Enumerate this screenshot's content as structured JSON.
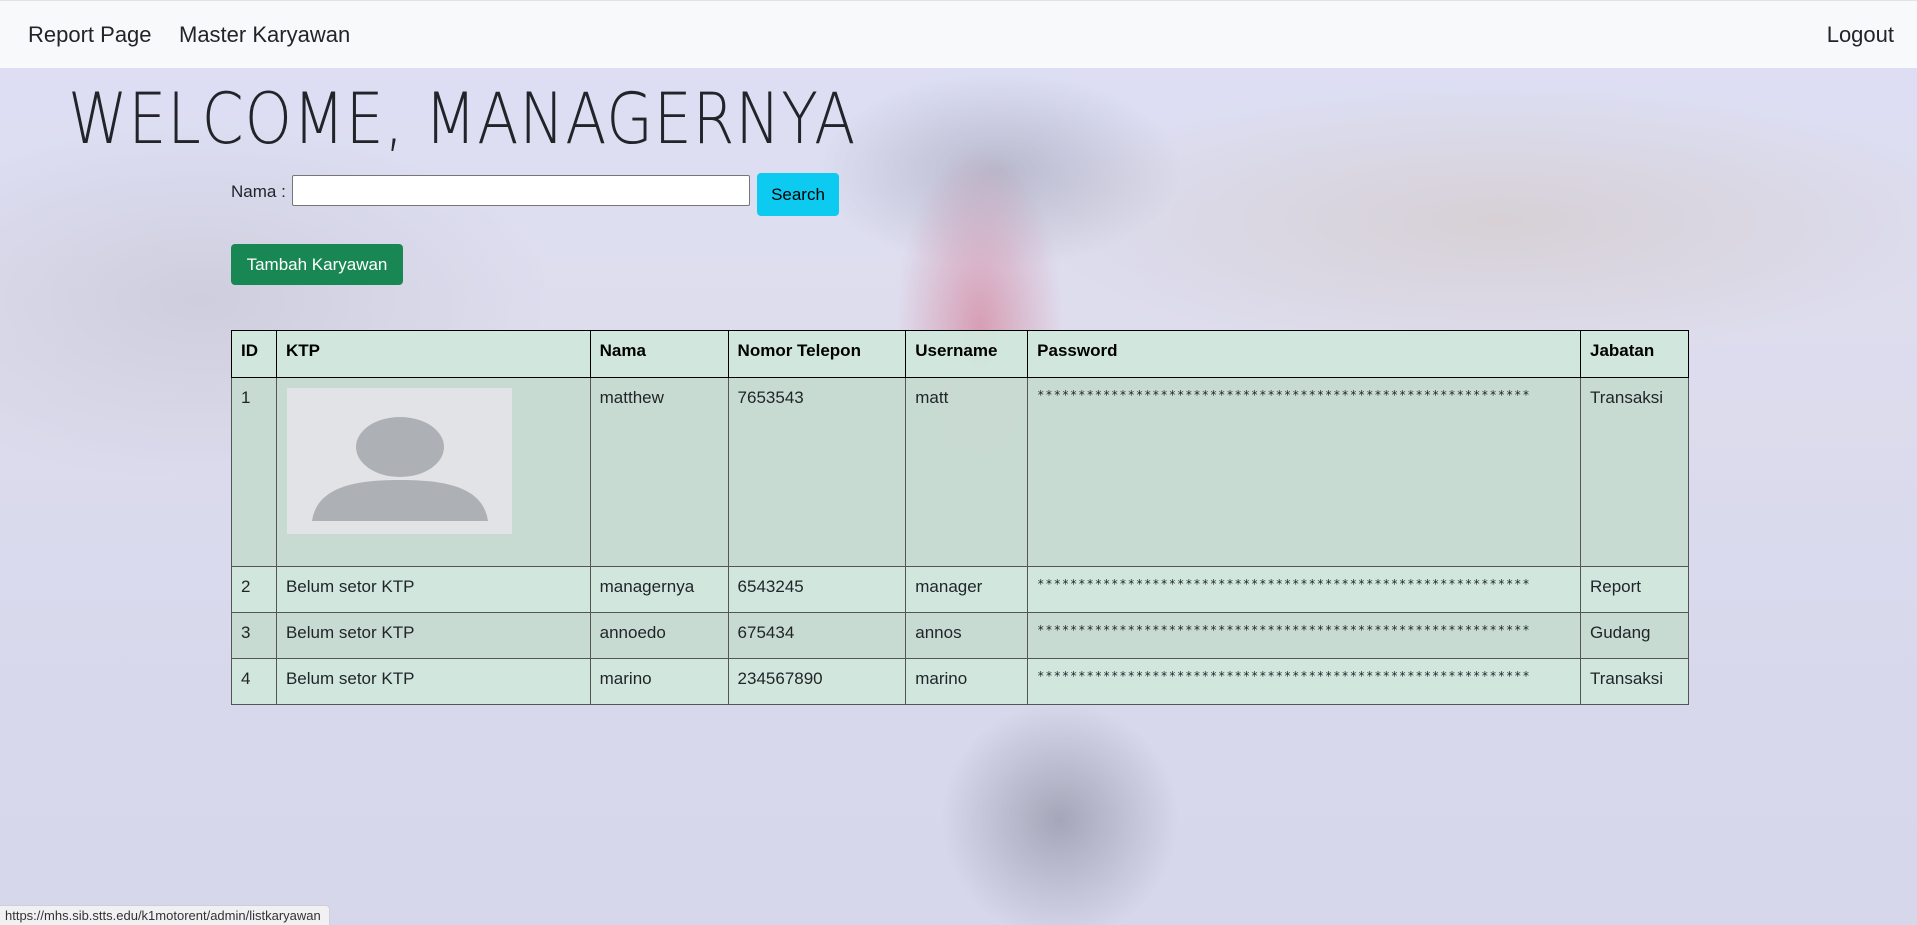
{
  "nav": {
    "report_label": "Report Page",
    "master_label": "Master Karyawan",
    "logout_label": "Logout"
  },
  "page": {
    "welcome": "WELCOME, MANAGERNYA"
  },
  "search": {
    "label": "Nama :",
    "value": "",
    "button_label": "Search"
  },
  "actions": {
    "add_label": "Tambah Karyawan"
  },
  "table": {
    "headers": [
      "ID",
      "KTP",
      "Nama",
      "Nomor Telepon",
      "Username",
      "Password",
      "Jabatan"
    ],
    "rows": [
      {
        "id": "1",
        "ktp": "",
        "nama": "matthew",
        "telepon": "7653543",
        "username": "matt",
        "password": "************************************************************",
        "jabatan": "Transaksi"
      },
      {
        "id": "2",
        "ktp": "Belum setor KTP",
        "nama": "managernya",
        "telepon": "6543245",
        "username": "manager",
        "password": "************************************************************",
        "jabatan": "Report"
      },
      {
        "id": "3",
        "ktp": "Belum setor KTP",
        "nama": "annoedo",
        "telepon": "675434",
        "username": "annos",
        "password": "************************************************************",
        "jabatan": "Gudang"
      },
      {
        "id": "4",
        "ktp": "Belum setor KTP",
        "nama": "marino",
        "telepon": "234567890",
        "username": "marino",
        "password": "************************************************************",
        "jabatan": "Transaksi"
      }
    ]
  },
  "status_bar": {
    "url": "https://mhs.sib.stts.edu/k1motorent/admin/listkaryawan"
  },
  "icons": {
    "ktp_placeholder": "person-placeholder-icon"
  },
  "colors": {
    "navbar_bg": "#f8f9fa",
    "search_button": "#0dcaf0",
    "add_button": "#198754",
    "table_row": "#d1e7dd"
  }
}
